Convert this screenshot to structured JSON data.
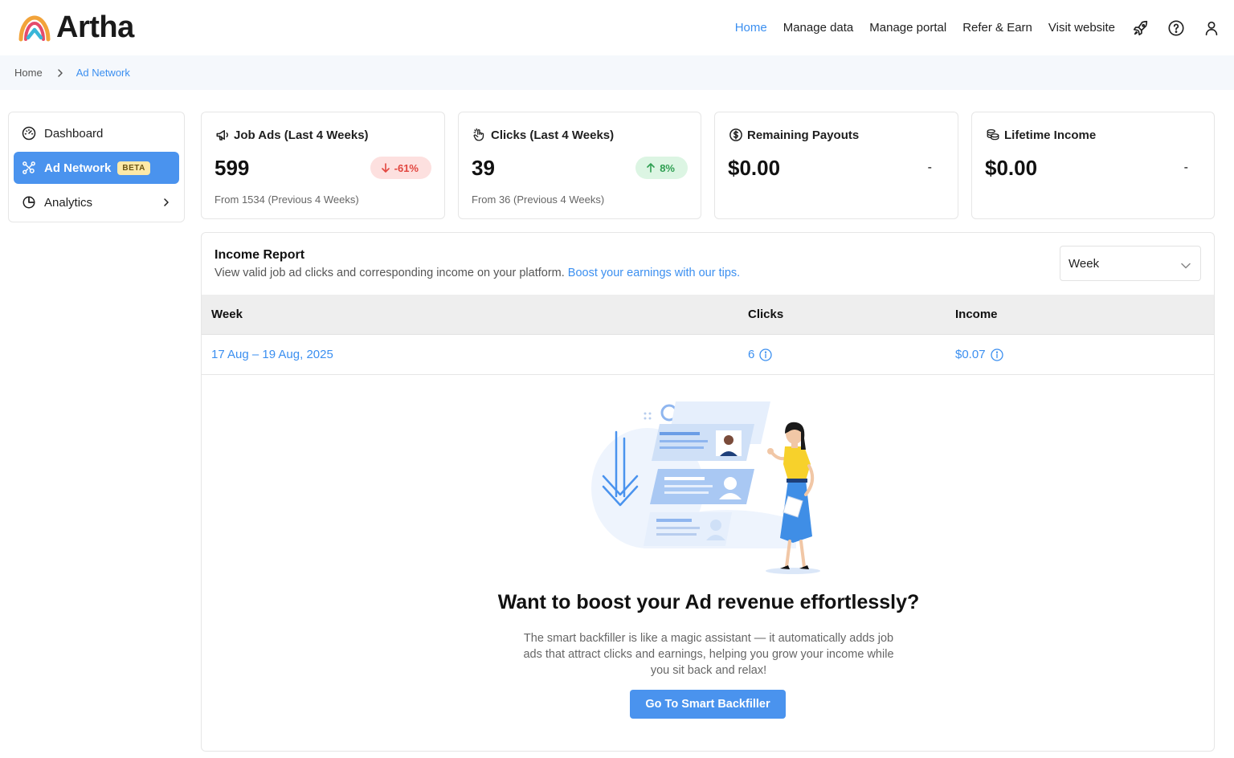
{
  "brand": {
    "name": "Artha"
  },
  "nav": {
    "links": [
      "Home",
      "Manage data",
      "Manage portal",
      "Refer & Earn",
      "Visit website"
    ],
    "icons": [
      "rocket-icon",
      "help-icon",
      "user-icon"
    ]
  },
  "breadcrumb": {
    "items": [
      "Home",
      "Ad Network"
    ]
  },
  "sidebar": {
    "items": [
      {
        "label": "Dashboard",
        "icon": "gauge-icon"
      },
      {
        "label": "Ad Network",
        "icon": "network-icon",
        "badge": "BETA"
      },
      {
        "label": "Analytics",
        "icon": "pie-chart-icon"
      }
    ]
  },
  "stats": [
    {
      "title": "Job Ads (Last 4 Weeks)",
      "value": "599",
      "change": "-61%",
      "trend": "down",
      "sub": "From 1534 (Previous 4 Weeks)"
    },
    {
      "title": "Clicks (Last 4 Weeks)",
      "value": "39",
      "change": "8%",
      "trend": "up",
      "sub": "From 36 (Previous 4 Weeks)"
    },
    {
      "title": "Remaining Payouts",
      "value": "$0.00",
      "change": "-"
    },
    {
      "title": "Lifetime Income",
      "value": "$0.00",
      "change": "-"
    }
  ],
  "income": {
    "title": "Income Report",
    "desc": "View valid job ad clicks and corresponding income on your platform.",
    "link": "Boost your earnings with our tips.",
    "select": "Week",
    "columns": [
      "Week",
      "Clicks",
      "Income"
    ],
    "rows": [
      {
        "week": "17 Aug – 19 Aug, 2025",
        "clicks": "6",
        "income": "$0.07"
      }
    ]
  },
  "promo": {
    "title": "Want to boost your Ad revenue effortlessly?",
    "text": "The smart backfiller is like a magic assistant — it automatically adds job ads that attract clicks and earnings, helping you grow your income while you sit back and relax!",
    "button": "Go To Smart Backfiller"
  },
  "colors": {
    "accent": "#4a93ee",
    "link": "#3b8ff0",
    "down": "#e2463f",
    "up": "#2f9f52",
    "beta": "#fde9a8"
  }
}
